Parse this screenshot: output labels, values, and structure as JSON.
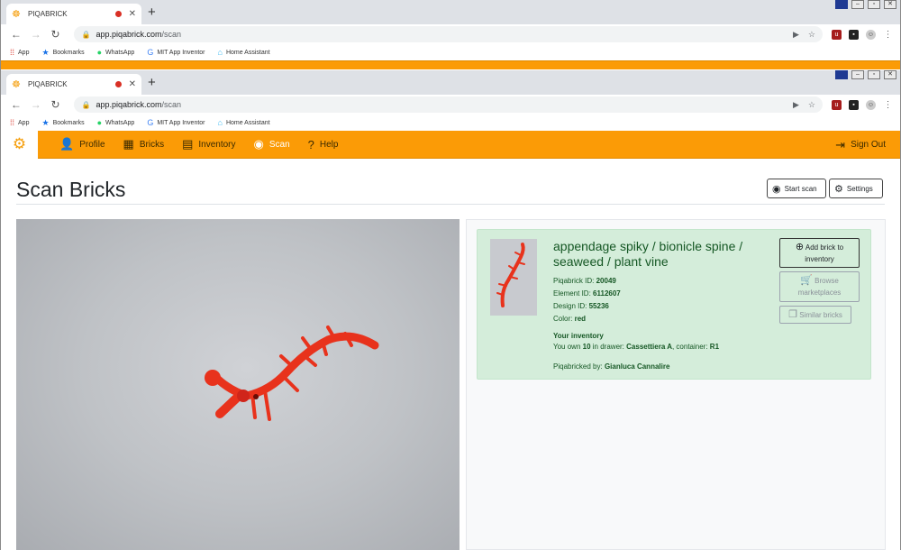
{
  "browser": {
    "tab_title": "PIQABRICK",
    "url_domain": "app.piqabrick.com",
    "url_path": "/scan",
    "bookmarks": [
      "App",
      "Bookmarks",
      "WhatsApp",
      "MIT App Inventor",
      "Home Assistant"
    ]
  },
  "nav": {
    "items": [
      "Profile",
      "Bricks",
      "Inventory",
      "Scan",
      "Help"
    ],
    "active": "Scan",
    "signout": "Sign Out"
  },
  "page": {
    "title": "Scan Bricks",
    "start_scan": "Start scan",
    "settings": "Settings"
  },
  "brick": {
    "name": "appendage spiky / bionicle spine / seaweed / plant vine",
    "piqabrick_id_label": "Piqabrick ID:",
    "piqabrick_id": "20049",
    "element_id_label": "Element ID:",
    "element_id": "6112607",
    "design_id_label": "Design ID:",
    "design_id": "55236",
    "color_label": "Color:",
    "color": "red",
    "inventory_title": "Your inventory",
    "own_prefix": "You own",
    "own_count": "10",
    "drawer_text": "in drawer:",
    "drawer": "Cassettiera A",
    "container_text": ", container:",
    "container": "R1",
    "piqabricked_label": "Piqabricked by:",
    "piqabricked_by": "Gianluca Cannalire"
  },
  "actions": {
    "add_line1": "Add brick to",
    "add_line2": "inventory",
    "browse_line1": "Browse",
    "browse_line2": "marketplaces",
    "similar": "Similar bricks"
  },
  "colors": {
    "accent": "#fb9b06",
    "card_bg": "#d4edda",
    "card_text": "#155724",
    "brick": "#e8321c"
  }
}
